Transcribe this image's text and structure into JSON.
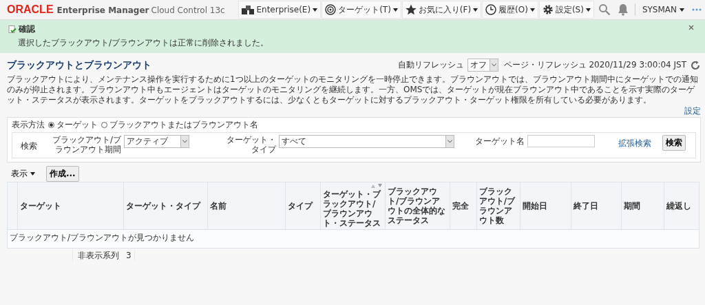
{
  "header": {
    "logo": "ORACLE",
    "product": "Enterprise Manager",
    "product_sub": "Cloud Control 13c",
    "menus": [
      {
        "label": "Enterprise(E)",
        "kind": "enterprise"
      },
      {
        "label": "ターゲット(T)",
        "kind": "target"
      },
      {
        "label": "お気に入り(F)",
        "kind": "star"
      },
      {
        "label": "履歴(O)",
        "kind": "clock"
      },
      {
        "label": "設定(S)",
        "kind": "gear"
      }
    ],
    "user": "SYSMAN"
  },
  "confirmation": {
    "title": "確認",
    "message": "選択したブラックアウト/ブラウンアウトは正常に削除されました。"
  },
  "page": {
    "title": "ブラックアウトとブラウンアウト",
    "auto_refresh_label": "自動リフレッシュ",
    "auto_refresh_value": "オフ",
    "page_refresh": "ページ・リフレッシュ 2020/11/29 3:00:04 JST",
    "description": "ブラックアウトにより、メンテナンス操作を実行するために1つ以上のターゲットのモニタリングを一時停止できます。ブラウンアウトでは、ブラウンアウト期間中にターゲットでの通知のみが抑止されます。ブラウンアウト中もエージェントはターゲットのモニタリングを継続します。一方、OMSでは、ターゲットが現在ブラウンアウト中であることを示す実際のターゲット・ステータスが表示されます。ターゲットをブラックアウトするには、少なくともターゲットに対するブラックアウト・ターゲット権限を所有している必要があります。",
    "settings_link": "設定"
  },
  "search": {
    "view_label": "表示方法",
    "radios": [
      {
        "label": "ターゲット",
        "selected": true
      },
      {
        "label": "ブラックアウトまたはブラウンアウト名",
        "selected": false
      }
    ],
    "search_label": "検索",
    "fields": [
      {
        "label": "ブラックアウト/ブラウンアウト期間",
        "value": "アクティブ",
        "kind": "select"
      },
      {
        "label": "ターゲット・タイプ",
        "value": "すべて",
        "kind": "select"
      },
      {
        "label": "ターゲット名",
        "kind": "text"
      }
    ],
    "advanced_link": "拡張検索",
    "search_button": "検索"
  },
  "toolbar": {
    "view_menu": "表示",
    "create_button": "作成..."
  },
  "table": {
    "columns": [
      {
        "label": "ターゲット",
        "sortable": false
      },
      {
        "label": "ターゲット・タイプ",
        "sortable": false
      },
      {
        "label": "名前",
        "sortable": false
      },
      {
        "label": "タイプ",
        "sortable": false
      },
      {
        "label": "ターゲット・ブラックアウト/ブラウンアウト・ステータス",
        "sortable": true
      },
      {
        "label": "ブラックアウト/ブラウンアウトの全体的なステータス",
        "sortable": false
      },
      {
        "label": "完全",
        "sortable": false
      },
      {
        "label": "ブラックアウト/ブラウンアウト数",
        "sortable": false
      },
      {
        "label": "開始日",
        "sortable": false
      },
      {
        "label": "終了日",
        "sortable": false
      },
      {
        "label": "期間",
        "sortable": false
      },
      {
        "label": "繰返し",
        "sortable": false
      }
    ],
    "empty_message": "ブラックアウト/ブラウンアウトが見つかりません"
  },
  "footer": {
    "hidden_columns_label": "非表示系列",
    "hidden_columns_count": "3"
  }
}
